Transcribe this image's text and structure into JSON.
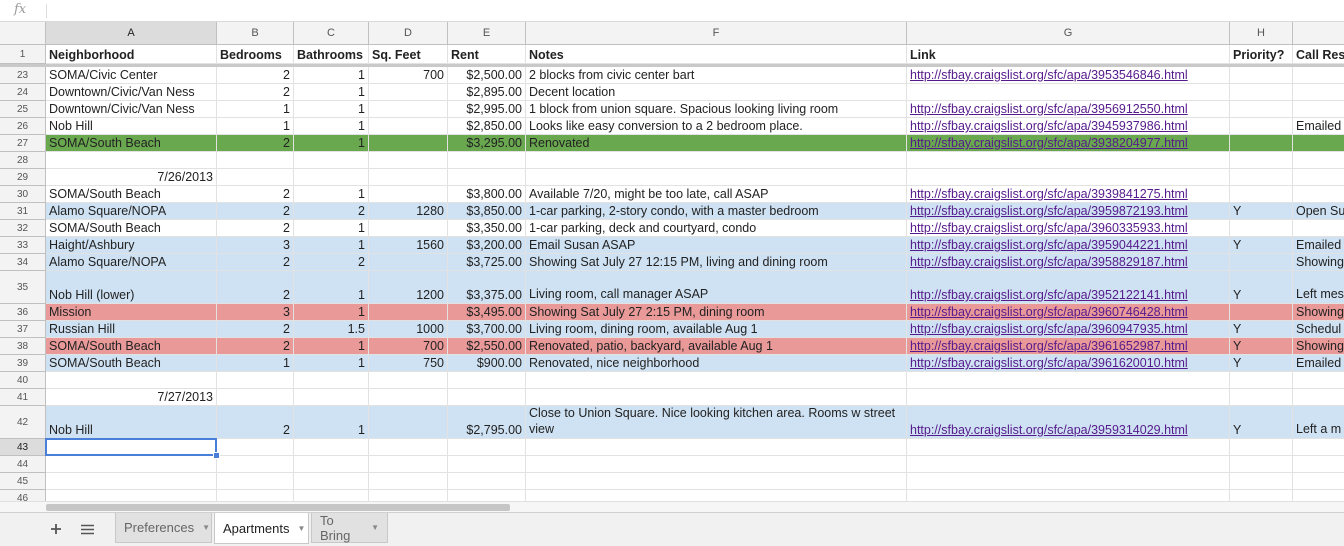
{
  "formula_bar": {
    "fx_label": "fx",
    "value": ""
  },
  "columns": [
    {
      "letter": "A"
    },
    {
      "letter": "B"
    },
    {
      "letter": "C"
    },
    {
      "letter": "D"
    },
    {
      "letter": "E"
    },
    {
      "letter": "F"
    },
    {
      "letter": "G"
    },
    {
      "letter": "H"
    },
    {
      "letter": ""
    }
  ],
  "selected": {
    "column": "A",
    "row": "43"
  },
  "header_row": {
    "num": "1",
    "cells": [
      "Neighborhood",
      "Bedrooms",
      "Bathrooms",
      "Sq. Feet",
      "Rent",
      "Notes",
      "Link",
      "Priority?",
      "Call Res"
    ]
  },
  "rows": [
    {
      "num": "23",
      "style": "",
      "cells": [
        "SOMA/Civic Center",
        "2",
        "1",
        "700",
        "$2,500.00",
        "2 blocks from civic center bart",
        "http://sfbay.craigslist.org/sfc/apa/3953546846.html",
        "",
        ""
      ]
    },
    {
      "num": "24",
      "style": "",
      "cells": [
        "Downtown/Civic/Van Ness",
        "2",
        "1",
        "",
        "$2,895.00",
        "Decent location",
        "",
        "",
        ""
      ]
    },
    {
      "num": "25",
      "style": "",
      "cells": [
        "Downtown/Civic/Van Ness",
        "1",
        "1",
        "",
        "$2,995.00",
        "1 block from union square. Spacious looking living room",
        "http://sfbay.craigslist.org/sfc/apa/3956912550.html",
        "",
        ""
      ]
    },
    {
      "num": "26",
      "style": "",
      "cells": [
        "Nob Hill",
        "1",
        "1",
        "",
        "$2,850.00",
        "Looks like easy conversion to a 2 bedroom place.",
        "http://sfbay.craigslist.org/sfc/apa/3945937986.html",
        "",
        "Emailed"
      ]
    },
    {
      "num": "27",
      "style": "green",
      "cells": [
        "SOMA/South Beach",
        "2",
        "1",
        "",
        "$3,295.00",
        "Renovated",
        "http://sfbay.craigslist.org/sfc/apa/3938204977.html",
        "",
        ""
      ]
    },
    {
      "num": "28",
      "style": "",
      "cells": [
        "",
        "",
        "",
        "",
        "",
        "",
        "",
        "",
        ""
      ]
    },
    {
      "num": "29",
      "style": "",
      "cells": [
        "7/26/2013",
        "",
        "",
        "",
        "",
        "",
        "",
        "",
        ""
      ]
    },
    {
      "num": "30",
      "style": "",
      "cells": [
        "SOMA/South Beach",
        "2",
        "1",
        "",
        "$3,800.00",
        "Available 7/20, might be too late, call ASAP",
        "http://sfbay.craigslist.org/sfc/apa/3939841275.html",
        "",
        ""
      ]
    },
    {
      "num": "31",
      "style": "blue",
      "cells": [
        "Alamo Square/NOPA",
        "2",
        "2",
        "1280",
        "$3,850.00",
        "1-car parking, 2-story condo, with a master bedroom",
        "http://sfbay.craigslist.org/sfc/apa/3959872193.html",
        "Y",
        "Open Su"
      ]
    },
    {
      "num": "32",
      "style": "",
      "cells": [
        "SOMA/South Beach",
        "2",
        "1",
        "",
        "$3,350.00",
        "1-car parking, deck and courtyard, condo",
        "http://sfbay.craigslist.org/sfc/apa/3960335933.html",
        "",
        ""
      ]
    },
    {
      "num": "33",
      "style": "blue",
      "cells": [
        "Haight/Ashbury",
        "3",
        "1",
        "1560",
        "$3,200.00",
        "Email Susan ASAP",
        "http://sfbay.craigslist.org/sfc/apa/3959044221.html",
        "Y",
        "Emailed"
      ]
    },
    {
      "num": "34",
      "style": "blue",
      "cells": [
        "Alamo Square/NOPA",
        "2",
        "2",
        "",
        "$3,725.00",
        "Showing Sat July 27 12:15 PM, living and dining room",
        "http://sfbay.craigslist.org/sfc/apa/3958829187.html",
        "",
        "Showing"
      ]
    },
    {
      "num": "35",
      "style": "blue",
      "tall": true,
      "cells": [
        "Nob Hill (lower)",
        "2",
        "1",
        "1200",
        "$3,375.00",
        "Living room, call manager ASAP",
        "http://sfbay.craigslist.org/sfc/apa/3952122141.html",
        "Y",
        "Left mes Deborah"
      ]
    },
    {
      "num": "36",
      "style": "red",
      "cells": [
        "Mission",
        "3",
        "1",
        "",
        "$3,495.00",
        "Showing Sat July 27 2:15 PM, dining room",
        "http://sfbay.craigslist.org/sfc/apa/3960746428.html",
        "",
        "Showing"
      ]
    },
    {
      "num": "37",
      "style": "blue",
      "cells": [
        "Russian Hill",
        "2",
        "1.5",
        "1000",
        "$3,700.00",
        "Living room, dining room, available Aug 1",
        "http://sfbay.craigslist.org/sfc/apa/3960947935.html",
        "Y",
        "Schedul"
      ]
    },
    {
      "num": "38",
      "style": "red",
      "cells": [
        "SOMA/South Beach",
        "2",
        "1",
        "700",
        "$2,550.00",
        "Renovated, patio, backyard, available Aug 1",
        "http://sfbay.craigslist.org/sfc/apa/3961652987.html",
        "Y",
        "Showing"
      ]
    },
    {
      "num": "39",
      "style": "blue",
      "cells": [
        "SOMA/South Beach",
        "1",
        "1",
        "750",
        "$900.00",
        "Renovated, nice neighborhood",
        "http://sfbay.craigslist.org/sfc/apa/3961620010.html",
        "Y",
        "Emailed"
      ]
    },
    {
      "num": "40",
      "style": "",
      "cells": [
        "",
        "",
        "",
        "",
        "",
        "",
        "",
        "",
        ""
      ]
    },
    {
      "num": "41",
      "style": "",
      "cells": [
        "7/27/2013",
        "",
        "",
        "",
        "",
        "",
        "",
        "",
        ""
      ]
    },
    {
      "num": "42",
      "style": "blue",
      "tall": true,
      "cells": [
        "Nob Hill",
        "2",
        "1",
        "",
        "$2,795.00",
        "Close to Union Square. Nice looking kitchen area. Rooms w street view",
        "http://sfbay.craigslist.org/sfc/apa/3959314029.html",
        "Y",
        "Left a m"
      ]
    },
    {
      "num": "43",
      "style": "",
      "cells": [
        "",
        "",
        "",
        "",
        "",
        "",
        "",
        "",
        ""
      ]
    },
    {
      "num": "44",
      "style": "",
      "cells": [
        "",
        "",
        "",
        "",
        "",
        "",
        "",
        "",
        ""
      ]
    },
    {
      "num": "45",
      "style": "",
      "cells": [
        "",
        "",
        "",
        "",
        "",
        "",
        "",
        "",
        ""
      ]
    },
    {
      "num": "46",
      "style": "",
      "cells": [
        "",
        "",
        "",
        "",
        "",
        "",
        "",
        "",
        ""
      ]
    }
  ],
  "tabs": [
    {
      "label": "Preferences",
      "active": false
    },
    {
      "label": "Apartments",
      "active": true
    },
    {
      "label": "To Bring",
      "active": false
    }
  ],
  "toolbar": {
    "add_sheet_icon": "plus-icon",
    "all_sheets_icon": "menu-icon"
  }
}
